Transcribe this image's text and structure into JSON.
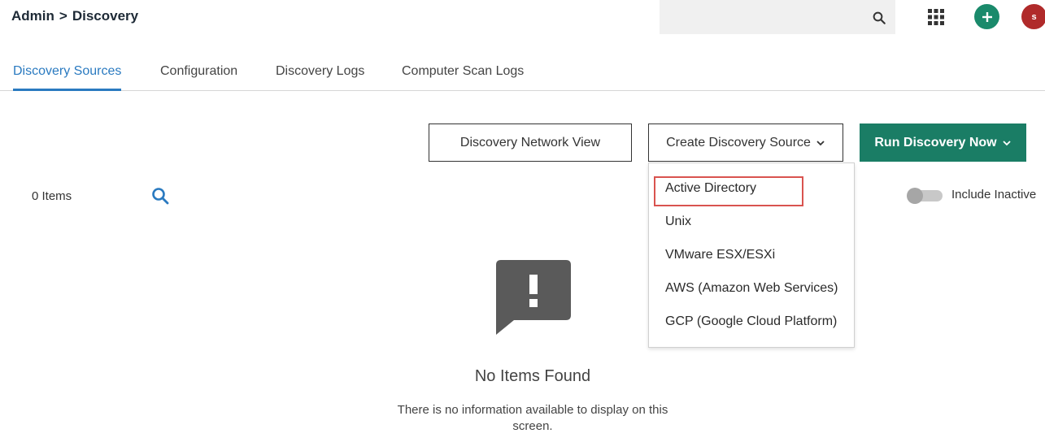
{
  "header": {
    "breadcrumb": [
      "Admin",
      "Discovery"
    ],
    "breadcrumb_separator": ">",
    "search_placeholder": "",
    "avatar_initial": "s",
    "colors": {
      "add_button": "#1a8a6b",
      "avatar": "#b02a2a"
    }
  },
  "tabs": [
    {
      "label": "Discovery Sources",
      "active": true
    },
    {
      "label": "Configuration",
      "active": false
    },
    {
      "label": "Discovery Logs",
      "active": false
    },
    {
      "label": "Computer Scan Logs",
      "active": false
    }
  ],
  "actions": {
    "network_view_label": "Discovery Network View",
    "create_source_label": "Create Discovery Source",
    "run_discovery_label": "Run Discovery Now"
  },
  "dropdown": {
    "items": [
      {
        "label": "Active Directory",
        "highlighted": true
      },
      {
        "label": "Unix"
      },
      {
        "label": "VMware ESX/ESXi"
      },
      {
        "label": "AWS (Amazon Web Services)"
      },
      {
        "label": "GCP (Google Cloud Platform)"
      }
    ]
  },
  "list": {
    "items_count": "0 Items",
    "include_inactive_label": "Include Inactive",
    "include_inactive_on": false
  },
  "empty_state": {
    "title": "No Items Found",
    "message_line1": "There is no information available to display on this",
    "message_line2": "screen."
  },
  "colors": {
    "accent": "#2a7ac0",
    "primary_button": "#1a7d65",
    "highlight_border": "#d9534f"
  }
}
